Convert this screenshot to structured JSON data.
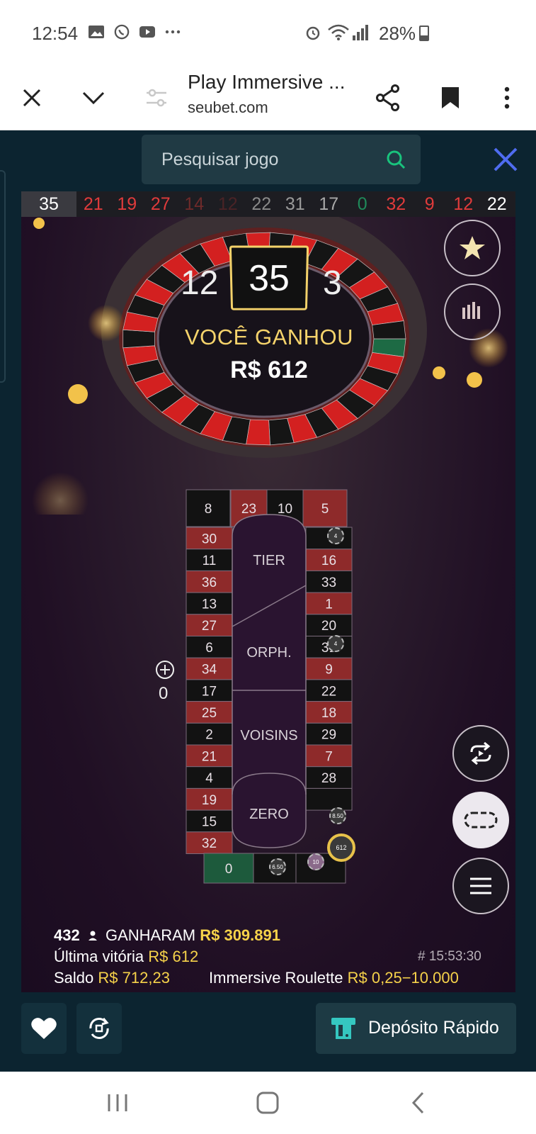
{
  "status_bar": {
    "time": "12:54",
    "battery": "28%",
    "icons": [
      "image-icon",
      "whatsapp-icon",
      "youtube-icon",
      "more-dots-icon",
      "alarm-icon",
      "wifi-icon",
      "signal-icon",
      "battery-icon"
    ]
  },
  "browser": {
    "title": "Play Immersive ...",
    "domain": "seubet.com",
    "buttons": [
      "close-icon",
      "chevron-down-icon",
      "site-settings-icon",
      "share-icon",
      "bookmark-icon",
      "more-vert-icon"
    ]
  },
  "search": {
    "placeholder": "Pesquisar jogo"
  },
  "history": {
    "latest": "35",
    "numbers": [
      {
        "n": "21",
        "color": "#e03b3b"
      },
      {
        "n": "19",
        "color": "#e03b3b"
      },
      {
        "n": "27",
        "color": "#e03b3b"
      },
      {
        "n": "14",
        "color": "#6e2a2a"
      },
      {
        "n": "12",
        "color": "#4a2326"
      },
      {
        "n": "22",
        "color": "#8a8a8a"
      },
      {
        "n": "31",
        "color": "#9a9a9a"
      },
      {
        "n": "17",
        "color": "#a8a8a8"
      },
      {
        "n": "0",
        "color": "#1f8a5a"
      },
      {
        "n": "32",
        "color": "#e03b3b"
      },
      {
        "n": "9",
        "color": "#e03b3b"
      },
      {
        "n": "12",
        "color": "#e03b3b"
      },
      {
        "n": "22",
        "color": "#ffffff"
      }
    ]
  },
  "result": {
    "left_number": "12",
    "winning_number": "35",
    "right_number": "3",
    "win_text": "VOCÊ GANHOU",
    "win_amount": "R$ 612"
  },
  "racetrack": {
    "top": [
      "8",
      "23",
      "10",
      "5"
    ],
    "left": [
      "30",
      "11",
      "36",
      "13",
      "27",
      "6",
      "34",
      "17",
      "25",
      "2",
      "21",
      "4",
      "19",
      "15",
      "32"
    ],
    "right": [
      "16",
      "33",
      "1",
      "20",
      "31",
      "9",
      "22",
      "18",
      "29",
      "7",
      "28"
    ],
    "bottom": [
      "0"
    ],
    "sections": [
      "TIER",
      "ORPH.",
      "VOISINS",
      "ZERO"
    ],
    "chips": [
      "4",
      "4",
      "8.50",
      "612",
      "10",
      "6.50"
    ]
  },
  "bet": {
    "plus_value": "0"
  },
  "stats": {
    "winners_count": "432",
    "winners_label": "GANHARAM",
    "winners_amount": "R$ 309.891",
    "last_win_label": "Última vitória",
    "last_win_amount": "R$ 612",
    "round_id": "# 15:53:30",
    "balance_label": "Saldo",
    "balance_amount": "R$ 712,23",
    "game_name": "Immersive Roulette",
    "limits": "R$ 0,25−10.000"
  },
  "toolbar": {
    "deposit_label": "Depósito Rápido"
  },
  "colors": {
    "accent_gold": "#f6d24a",
    "search_green": "#19c37d",
    "close_blue": "#4f6cf0",
    "red_pocket": "#8e2a2a",
    "black_pocket": "#121212",
    "green_pocket": "#1d5a3c"
  }
}
